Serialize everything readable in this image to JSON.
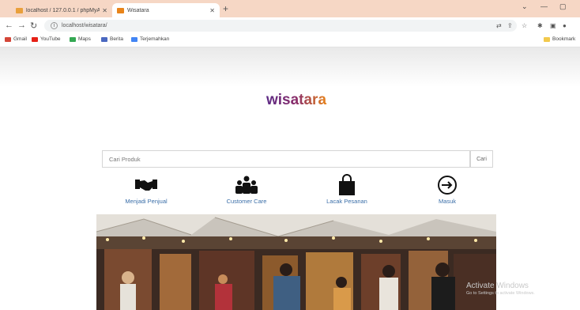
{
  "browser": {
    "tabs": [
      {
        "title": "localhost / 127.0.0.1 / phpMyAd",
        "active": false
      },
      {
        "title": "Wisatara",
        "active": true
      }
    ],
    "address": "localhost/wisatara/",
    "bookmarks": [
      {
        "label": "Gmail",
        "icon": "gmail-icon"
      },
      {
        "label": "YouTube",
        "icon": "youtube-icon"
      },
      {
        "label": "Maps",
        "icon": "maps-icon"
      },
      {
        "label": "Berita",
        "icon": "news-icon"
      },
      {
        "label": "Terjemahkan",
        "icon": "translate-icon"
      }
    ],
    "bookmarks_right": "Bookmark"
  },
  "brand": {
    "name": "wisatara"
  },
  "search": {
    "placeholder": "Cari Produk",
    "button_label": "Cari"
  },
  "features": [
    {
      "label": "Menjadi Penjual",
      "icon": "handshake-icon"
    },
    {
      "label": "Customer Care",
      "icon": "users-icon"
    },
    {
      "label": "Lacak Pesanan",
      "icon": "shopping-bag-icon"
    },
    {
      "label": "Masuk",
      "icon": "sign-in-icon"
    }
  ],
  "watermark": {
    "line1": "Activate Windows",
    "line2": "Go to Settings to activate Windows."
  },
  "colors": {
    "tabbar": "#f6d7c5",
    "link": "#3a6ea8",
    "logo_purple": "#5b2a86",
    "logo_orange": "#e8841a"
  }
}
